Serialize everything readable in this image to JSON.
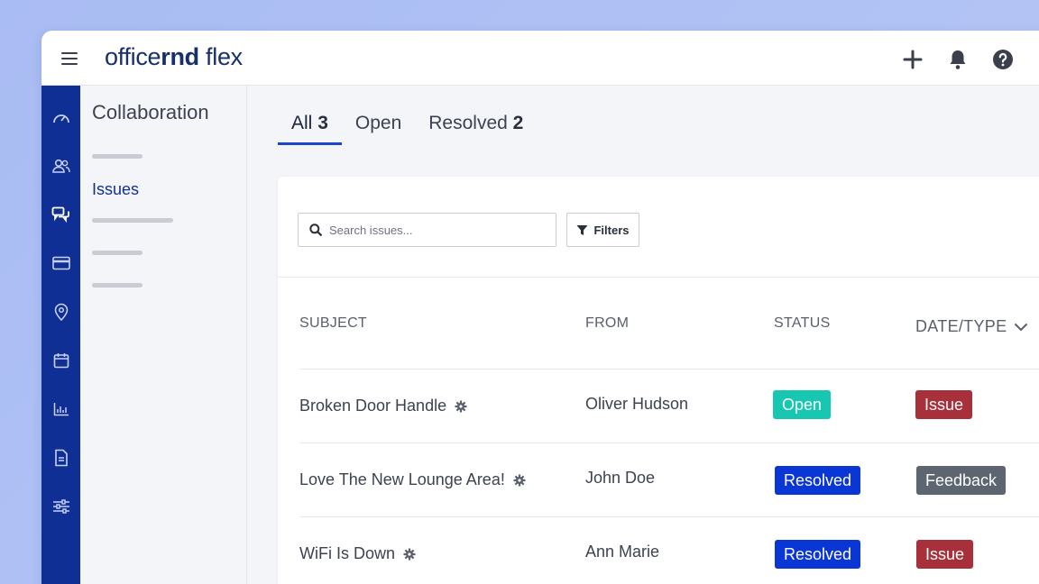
{
  "app": {
    "logo_regular": "office",
    "logo_bold": "rnd",
    "logo_suffix": " flex"
  },
  "topbar": {
    "icons": [
      "plus-icon",
      "bell-icon",
      "help-icon"
    ]
  },
  "rail": {
    "icons": [
      "dashboard-icon",
      "members-icon",
      "collaboration-icon",
      "billing-icon",
      "location-icon",
      "calendar-icon",
      "reports-icon",
      "documents-icon",
      "settings-icon"
    ]
  },
  "subnav": {
    "title": "Collaboration",
    "active_item": "Issues"
  },
  "tabs": [
    {
      "label": "All",
      "count": "3",
      "active": true
    },
    {
      "label": "Open",
      "count": ""
    },
    {
      "label": "Resolved",
      "count": "2"
    }
  ],
  "toolbar": {
    "search_placeholder": "Search issues...",
    "filters_label": "Filters"
  },
  "table": {
    "headers": {
      "subject": "SUBJECT",
      "from": "FROM",
      "status": "STATUS",
      "date_type": "DATE/TYPE"
    },
    "rows": [
      {
        "subject": "Broken Door Handle",
        "from": "Oliver Hudson",
        "status": "Open",
        "type": "Issue"
      },
      {
        "subject": "Love The New Lounge Area!",
        "from": "John Doe",
        "status": "Resolved",
        "type": "Feedback"
      },
      {
        "subject": "WiFi Is Down",
        "from": "Ann Marie",
        "status": "Resolved",
        "type": "Issue"
      }
    ]
  },
  "colors": {
    "brand": "#17306b",
    "rail": "#0f2f95",
    "open": "#17c7b1",
    "resolved": "#0b36d6",
    "issue": "#a8303a",
    "feedback": "#5c6570",
    "tab_underline": "#1b45c9"
  }
}
